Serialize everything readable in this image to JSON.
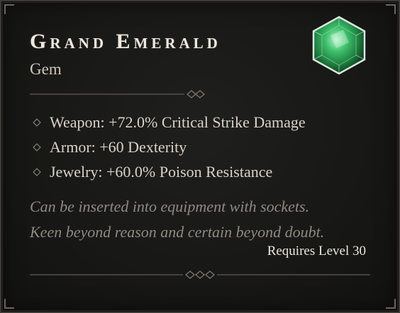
{
  "item": {
    "name": "Grand Emerald",
    "type": "Gem",
    "icon": "emerald-gem-icon",
    "gem_color": "#2fa85a"
  },
  "affixes": [
    "Weapon: +72.0% Critical Strike Damage",
    "Armor: +60 Dexterity",
    "Jewelry: +60.0% Poison Resistance"
  ],
  "flavor": [
    "Can be inserted into equipment with sockets.",
    "Keen beyond reason and certain beyond doubt."
  ],
  "requirement": "Requires Level 30",
  "colors": {
    "title": "#efe9df",
    "text": "#d9d3c7",
    "flavor": "#8e8a82",
    "border": "#3d3a36"
  }
}
